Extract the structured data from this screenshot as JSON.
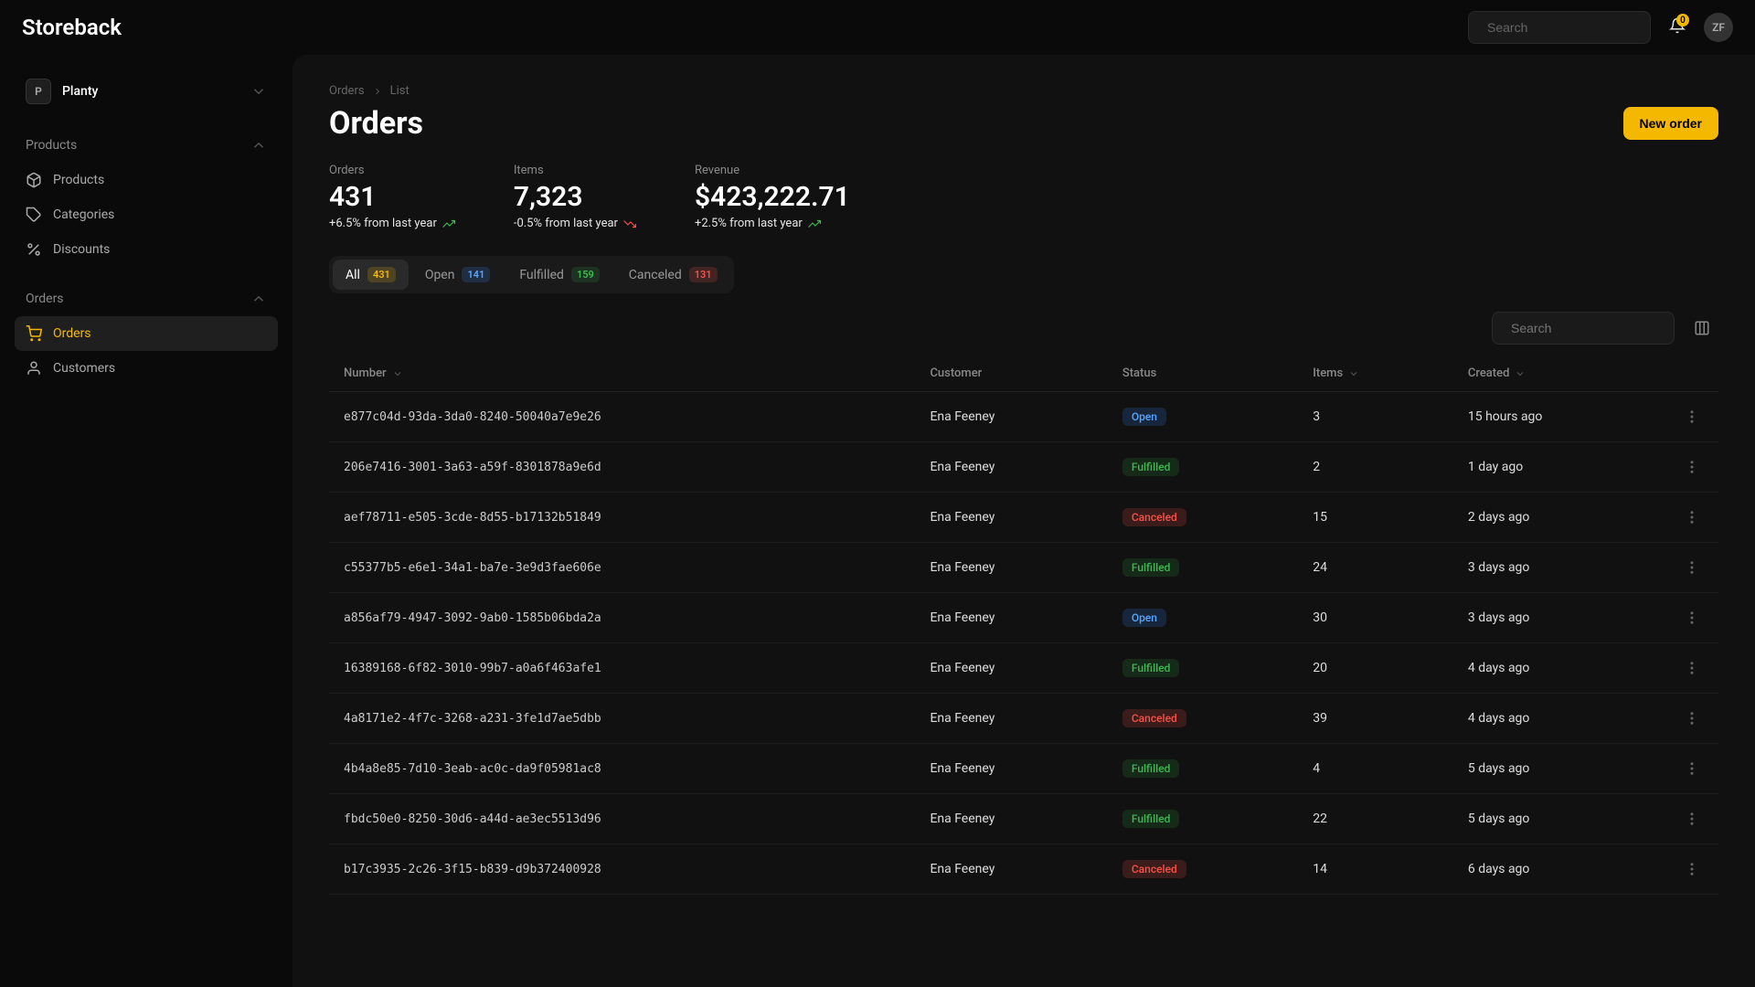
{
  "brand": "Storeback",
  "top": {
    "search_placeholder": "Search",
    "notif_count": "0",
    "avatar_initials": "ZF"
  },
  "workspace": {
    "badge": "P",
    "name": "Planty"
  },
  "sidebar": {
    "products_header": "Products",
    "products_items": [
      {
        "label": "Products",
        "icon": "package-icon"
      },
      {
        "label": "Categories",
        "icon": "tag-icon"
      },
      {
        "label": "Discounts",
        "icon": "percent-icon"
      }
    ],
    "orders_header": "Orders",
    "orders_items": [
      {
        "label": "Orders",
        "icon": "cart-icon",
        "active": true
      },
      {
        "label": "Customers",
        "icon": "user-icon"
      }
    ]
  },
  "breadcrumb": {
    "a": "Orders",
    "b": "List"
  },
  "page_title": "Orders",
  "new_order_label": "New order",
  "stats": [
    {
      "label": "Orders",
      "value": "431",
      "change": "+6.5% from last year",
      "dir": "up"
    },
    {
      "label": "Items",
      "value": "7,323",
      "change": "-0.5% from last year",
      "dir": "down"
    },
    {
      "label": "Revenue",
      "value": "$423,222.71",
      "change": "+2.5% from last year",
      "dir": "up"
    }
  ],
  "tabs": [
    {
      "label": "All",
      "count": "431",
      "color": "yellow",
      "active": true
    },
    {
      "label": "Open",
      "count": "141",
      "color": "blue"
    },
    {
      "label": "Fulfilled",
      "count": "159",
      "color": "green"
    },
    {
      "label": "Canceled",
      "count": "131",
      "color": "red"
    }
  ],
  "table_search_placeholder": "Search",
  "columns": {
    "number": "Number",
    "customer": "Customer",
    "status": "Status",
    "items": "Items",
    "created": "Created"
  },
  "rows": [
    {
      "number": "e877c04d-93da-3da0-8240-50040a7e9e26",
      "customer": "Ena Feeney",
      "status": "Open",
      "status_color": "blue",
      "items": "3",
      "created": "15 hours ago"
    },
    {
      "number": "206e7416-3001-3a63-a59f-8301878a9e6d",
      "customer": "Ena Feeney",
      "status": "Fulfilled",
      "status_color": "green",
      "items": "2",
      "created": "1 day ago"
    },
    {
      "number": "aef78711-e505-3cde-8d55-b17132b51849",
      "customer": "Ena Feeney",
      "status": "Canceled",
      "status_color": "red",
      "items": "15",
      "created": "2 days ago"
    },
    {
      "number": "c55377b5-e6e1-34a1-ba7e-3e9d3fae606e",
      "customer": "Ena Feeney",
      "status": "Fulfilled",
      "status_color": "green",
      "items": "24",
      "created": "3 days ago"
    },
    {
      "number": "a856af79-4947-3092-9ab0-1585b06bda2a",
      "customer": "Ena Feeney",
      "status": "Open",
      "status_color": "blue",
      "items": "30",
      "created": "3 days ago"
    },
    {
      "number": "16389168-6f82-3010-99b7-a0a6f463afe1",
      "customer": "Ena Feeney",
      "status": "Fulfilled",
      "status_color": "green",
      "items": "20",
      "created": "4 days ago"
    },
    {
      "number": "4a8171e2-4f7c-3268-a231-3fe1d7ae5dbb",
      "customer": "Ena Feeney",
      "status": "Canceled",
      "status_color": "red",
      "items": "39",
      "created": "4 days ago"
    },
    {
      "number": "4b4a8e85-7d10-3eab-ac0c-da9f05981ac8",
      "customer": "Ena Feeney",
      "status": "Fulfilled",
      "status_color": "green",
      "items": "4",
      "created": "5 days ago"
    },
    {
      "number": "fbdc50e0-8250-30d6-a44d-ae3ec5513d96",
      "customer": "Ena Feeney",
      "status": "Fulfilled",
      "status_color": "green",
      "items": "22",
      "created": "5 days ago"
    },
    {
      "number": "b17c3935-2c26-3f15-b839-d9b372400928",
      "customer": "Ena Feeney",
      "status": "Canceled",
      "status_color": "red",
      "items": "14",
      "created": "6 days ago"
    }
  ]
}
